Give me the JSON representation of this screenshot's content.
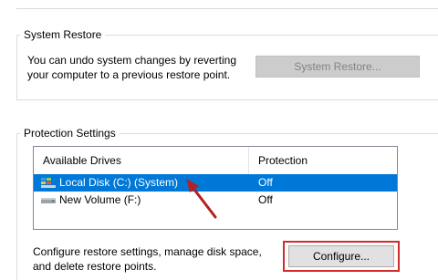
{
  "system_restore": {
    "group_title": "System Restore",
    "description": "You can undo system changes by reverting your computer to a previous restore point.",
    "button_label": "System Restore..."
  },
  "protection_settings": {
    "group_title": "Protection Settings",
    "columns": [
      "Available Drives",
      "Protection"
    ],
    "drives": [
      {
        "name": "Local Disk (C:) (System)",
        "protection": "Off",
        "selected": true,
        "icon": "system-drive-icon"
      },
      {
        "name": "New Volume (F:)",
        "protection": "Off",
        "selected": false,
        "icon": "drive-icon"
      }
    ],
    "configure_description": "Configure restore settings, manage disk space, and delete restore points.",
    "configure_label": "Configure..."
  },
  "colors": {
    "selection": "#0078d7",
    "highlight_box": "#d42a2a",
    "arrow": "#b52020"
  }
}
